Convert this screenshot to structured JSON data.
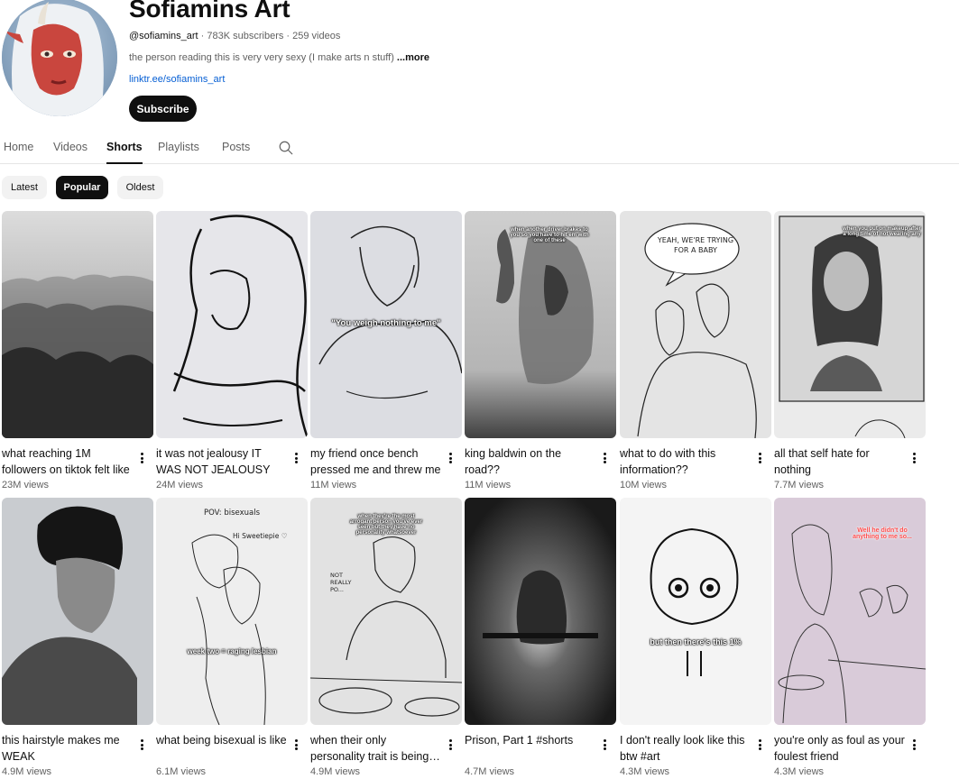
{
  "channel": {
    "name": "Sofiamins Art",
    "handle": "@sofiamins_art",
    "stats": " · 783K subscribers · 259 videos",
    "description": "the person reading this is very very sexy (I make arts n stuff) ",
    "more_label": "...more",
    "link": "linktr.ee/sofiamins_art",
    "subscribe_label": "Subscribe"
  },
  "tabs": [
    {
      "label": "Home"
    },
    {
      "label": "Videos"
    },
    {
      "label": "Shorts",
      "active": true
    },
    {
      "label": "Playlists"
    },
    {
      "label": "Posts"
    }
  ],
  "sort_chips": [
    {
      "label": "Latest"
    },
    {
      "label": "Popular",
      "active": true
    },
    {
      "label": "Oldest"
    }
  ],
  "shorts": [
    {
      "title": "what reaching 1M followers on tiktok felt like",
      "views": "23M views",
      "overlay": ""
    },
    {
      "title": "it was not jealousy IT WAS NOT JEALOUSY",
      "views": "24M views",
      "overlay": ""
    },
    {
      "title": "my friend once bench pressed me and threw me",
      "views": "11M views",
      "overlay": "\"You weigh nothing to me\""
    },
    {
      "title": "king baldwin on the road??",
      "views": "11M views",
      "overlay": "when another driver brakes to you so you have to hit em with one of these"
    },
    {
      "title": "what to do with this information??",
      "views": "10M views",
      "overlay": "YEAH, WE'RE TRYING FOR A BABY"
    },
    {
      "title": "all that self hate for nothing",
      "views": "7.7M views",
      "overlay": "when you put on makeup after a long time of not wearing any"
    },
    {
      "title": "this hairstyle makes me WEAK",
      "views": "4.9M views",
      "overlay": ""
    },
    {
      "title": "what being bisexual is like",
      "views": "6.1M views",
      "overlay": "POV: bisexuals",
      "overlay2": "week two = raging lesbian",
      "overlay3": "Hi Sweetiepie ♡"
    },
    {
      "title": "when their only personality trait is being a hater",
      "views": "4.9M views",
      "overlay": "when they're the most arrogant person you've ever seen but they have no personality whatsoever",
      "overlay2": "NOT REALLY PO..."
    },
    {
      "title": "Prison, Part 1 #shorts",
      "views": "4.7M views",
      "overlay": ""
    },
    {
      "title": "I don't really look like this btw #art",
      "views": "4.3M views",
      "overlay": "but then there's this 1%"
    },
    {
      "title": "you're only as foul as your foulest friend",
      "views": "4.3M views",
      "overlay": "Well he didn't do anything to me so..."
    }
  ],
  "icons": {
    "search": "search-icon",
    "more": "more-vert-icon"
  },
  "colors": {
    "text_primary": "#0f0f0f",
    "text_secondary": "#606060",
    "link": "#065fd4",
    "button_dark": "#0f0f0f",
    "chip_bg": "#f2f2f2"
  }
}
